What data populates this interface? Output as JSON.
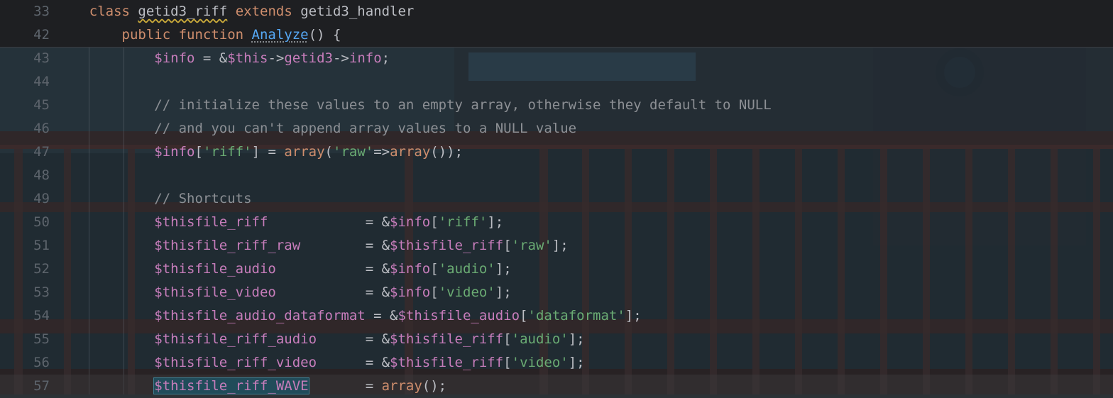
{
  "sticky": [
    {
      "ln": "33",
      "indent": "    ",
      "tokens": [
        {
          "t": "class ",
          "c": "kw"
        },
        {
          "t": "getid3_riff",
          "c": "pl cls-u"
        },
        {
          "t": " extends ",
          "c": "kw"
        },
        {
          "t": "getid3_handler",
          "c": "pl"
        }
      ]
    },
    {
      "ln": "42",
      "indent": "        ",
      "tokens": [
        {
          "t": "public function ",
          "c": "kw"
        },
        {
          "t": "Analyze",
          "c": "fn fn-u"
        },
        {
          "t": "() {",
          "c": "pl"
        }
      ]
    }
  ],
  "lines": [
    {
      "ln": "43",
      "tokens": [
        {
          "t": "$info",
          "c": "var"
        },
        {
          "t": " = &",
          "c": "pl"
        },
        {
          "t": "$this",
          "c": "var"
        },
        {
          "t": "->",
          "c": "pl"
        },
        {
          "t": "getid3",
          "c": "var"
        },
        {
          "t": "->",
          "c": "pl"
        },
        {
          "t": "info",
          "c": "var"
        },
        {
          "t": ";",
          "c": "pl"
        }
      ]
    },
    {
      "ln": "44",
      "tokens": []
    },
    {
      "ln": "45",
      "tokens": [
        {
          "t": "// initialize these values to an empty array, otherwise they default to NULL",
          "c": "cm"
        }
      ]
    },
    {
      "ln": "46",
      "tokens": [
        {
          "t": "// and you can't append array values to a NULL value",
          "c": "cm"
        }
      ]
    },
    {
      "ln": "47",
      "tokens": [
        {
          "t": "$info",
          "c": "var"
        },
        {
          "t": "[",
          "c": "pl"
        },
        {
          "t": "'riff'",
          "c": "str"
        },
        {
          "t": "] = ",
          "c": "pl"
        },
        {
          "t": "array",
          "c": "kw"
        },
        {
          "t": "(",
          "c": "pl"
        },
        {
          "t": "'raw'",
          "c": "str"
        },
        {
          "t": "=>",
          "c": "pl"
        },
        {
          "t": "array",
          "c": "kw"
        },
        {
          "t": "());",
          "c": "pl"
        }
      ]
    },
    {
      "ln": "48",
      "tokens": []
    },
    {
      "ln": "49",
      "tokens": [
        {
          "t": "// Shortcuts",
          "c": "cm"
        }
      ]
    },
    {
      "ln": "50",
      "tokens": [
        {
          "t": "$thisfile_riff",
          "c": "var"
        },
        {
          "t": "            = &",
          "c": "pl"
        },
        {
          "t": "$info",
          "c": "var"
        },
        {
          "t": "[",
          "c": "pl"
        },
        {
          "t": "'riff'",
          "c": "str"
        },
        {
          "t": "];",
          "c": "pl"
        }
      ]
    },
    {
      "ln": "51",
      "tokens": [
        {
          "t": "$thisfile_riff_raw",
          "c": "var"
        },
        {
          "t": "        = &",
          "c": "pl"
        },
        {
          "t": "$thisfile_riff",
          "c": "var"
        },
        {
          "t": "[",
          "c": "pl"
        },
        {
          "t": "'raw'",
          "c": "str"
        },
        {
          "t": "];",
          "c": "pl"
        }
      ]
    },
    {
      "ln": "52",
      "tokens": [
        {
          "t": "$thisfile_audio",
          "c": "var"
        },
        {
          "t": "           = &",
          "c": "pl"
        },
        {
          "t": "$info",
          "c": "var"
        },
        {
          "t": "[",
          "c": "pl"
        },
        {
          "t": "'audio'",
          "c": "str"
        },
        {
          "t": "];",
          "c": "pl"
        }
      ]
    },
    {
      "ln": "53",
      "tokens": [
        {
          "t": "$thisfile_video",
          "c": "var"
        },
        {
          "t": "           = &",
          "c": "pl"
        },
        {
          "t": "$info",
          "c": "var"
        },
        {
          "t": "[",
          "c": "pl"
        },
        {
          "t": "'video'",
          "c": "str"
        },
        {
          "t": "];",
          "c": "pl"
        }
      ]
    },
    {
      "ln": "54",
      "tokens": [
        {
          "t": "$thisfile_audio_dataformat",
          "c": "var"
        },
        {
          "t": " = &",
          "c": "pl"
        },
        {
          "t": "$thisfile_audio",
          "c": "var"
        },
        {
          "t": "[",
          "c": "pl"
        },
        {
          "t": "'dataformat'",
          "c": "str"
        },
        {
          "t": "];",
          "c": "pl"
        }
      ]
    },
    {
      "ln": "55",
      "tokens": [
        {
          "t": "$thisfile_riff_audio",
          "c": "var"
        },
        {
          "t": "      = &",
          "c": "pl"
        },
        {
          "t": "$thisfile_riff",
          "c": "var"
        },
        {
          "t": "[",
          "c": "pl"
        },
        {
          "t": "'audio'",
          "c": "str"
        },
        {
          "t": "];",
          "c": "pl"
        }
      ]
    },
    {
      "ln": "56",
      "tokens": [
        {
          "t": "$thisfile_riff_video",
          "c": "var"
        },
        {
          "t": "      = &",
          "c": "pl"
        },
        {
          "t": "$thisfile_riff",
          "c": "var"
        },
        {
          "t": "[",
          "c": "pl"
        },
        {
          "t": "'video'",
          "c": "str"
        },
        {
          "t": "];",
          "c": "pl"
        }
      ]
    },
    {
      "ln": "57",
      "current": true,
      "tokens": [
        {
          "t": "$thisfile_riff_WAVE",
          "c": "var sel"
        },
        {
          "t": "       = ",
          "c": "pl"
        },
        {
          "t": "array",
          "c": "kw"
        },
        {
          "t": "();",
          "c": "pl"
        }
      ]
    }
  ],
  "code_indent": "            ",
  "colors": {
    "keyword": "#cf8e6d",
    "variable": "#c77dbb",
    "string": "#6aab73",
    "comment": "#8c8f94",
    "function": "#56a8f5",
    "text": "#bcbec4"
  }
}
